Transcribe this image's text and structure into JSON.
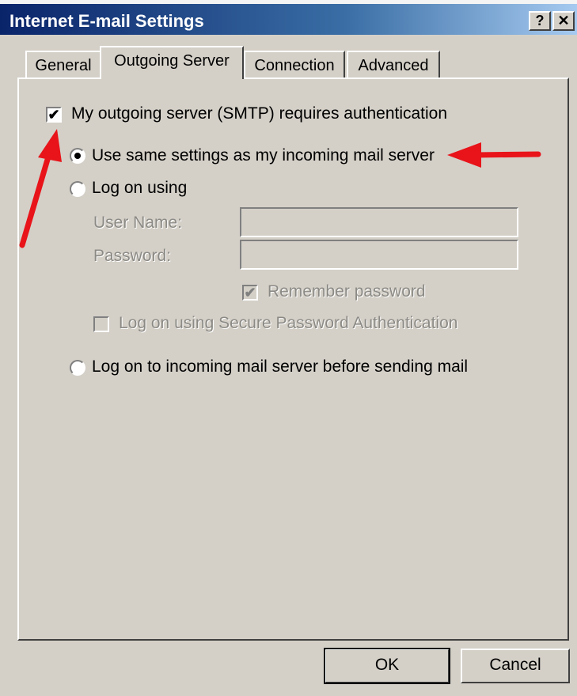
{
  "window": {
    "title": "Internet E-mail Settings",
    "help_label": "?",
    "close_label": "✕"
  },
  "tabs": [
    {
      "label": "General",
      "active": false
    },
    {
      "label": "Outgoing Server",
      "active": true
    },
    {
      "label": "Connection",
      "active": false
    },
    {
      "label": "Advanced",
      "active": false
    }
  ],
  "outgoing": {
    "requires_auth_label": "My outgoing server (SMTP) requires authentication",
    "requires_auth_checked": true,
    "same_settings_label": "Use same settings as my incoming mail server",
    "same_settings_selected": true,
    "log_on_using_label": "Log on using",
    "log_on_using_selected": false,
    "username_label": "User Name:",
    "username_value": "",
    "password_label": "Password:",
    "password_value": "",
    "remember_password_label": "Remember password",
    "remember_password_checked": true,
    "spa_label": "Log on using Secure Password Authentication",
    "spa_checked": false,
    "log_on_incoming_label": "Log on to incoming mail server before sending mail",
    "log_on_incoming_selected": false
  },
  "buttons": {
    "ok": "OK",
    "cancel": "Cancel"
  },
  "annotation_color": "#e8141a"
}
